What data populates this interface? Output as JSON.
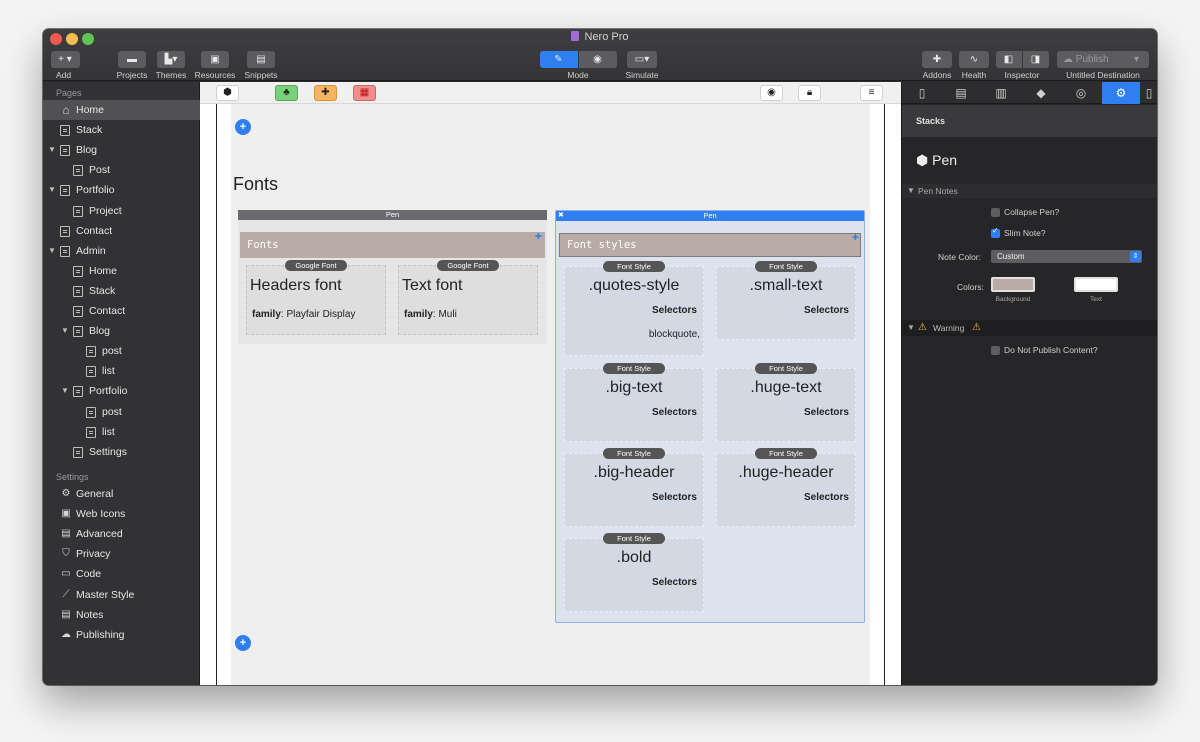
{
  "window": {
    "title": "Nero Pro",
    "traffic_lights": [
      "#ee5a52",
      "#f5bd4f",
      "#5fc454"
    ]
  },
  "toolbar": {
    "add_label": "Add",
    "add_button": "+",
    "projects_label": "Projects",
    "themes_label": "Themes",
    "resources_label": "Resources",
    "snippets_label": "Snippets",
    "mode_label": "Mode",
    "simulate_label": "Simulate",
    "addons_label": "Addons",
    "health_label": "Health",
    "inspector_label": "Inspector",
    "publish_button": "Publish",
    "destination_label": "Untitled Destination"
  },
  "sidebar": {
    "pages_header": "Pages",
    "pages": [
      {
        "label": "Home",
        "selected": true
      },
      {
        "label": "Stack"
      },
      {
        "label": "Blog",
        "expanded": true
      },
      {
        "label": "Post"
      },
      {
        "label": "Portfolio",
        "expanded": true
      },
      {
        "label": "Project"
      },
      {
        "label": "Contact"
      },
      {
        "label": "Admin",
        "expanded": true
      },
      {
        "label": "Home"
      },
      {
        "label": "Stack"
      },
      {
        "label": "Contact"
      },
      {
        "label": "Blog",
        "expanded": true
      },
      {
        "label": "post"
      },
      {
        "label": "list"
      },
      {
        "label": "Portfolio",
        "expanded": true
      },
      {
        "label": "post"
      },
      {
        "label": "list"
      },
      {
        "label": "Settings"
      }
    ],
    "settings_header": "Settings",
    "settings": [
      {
        "label": "General",
        "icon": "gear-icon"
      },
      {
        "label": "Web Icons",
        "icon": "web-icons-icon"
      },
      {
        "label": "Advanced",
        "icon": "advanced-icon"
      },
      {
        "label": "Privacy",
        "icon": "shield-icon"
      },
      {
        "label": "Code",
        "icon": "code-icon"
      },
      {
        "label": "Master Style",
        "icon": "wand-icon"
      },
      {
        "label": "Notes",
        "icon": "notes-icon"
      },
      {
        "label": "Publishing",
        "icon": "cloud-icon"
      }
    ]
  },
  "canvas": {
    "heading": "Fonts",
    "pen_left": {
      "bar_label": "Pen",
      "title": "Fonts",
      "cards": [
        {
          "badge": "Google Font",
          "name": "Headers font",
          "family_key": "family",
          "family_value": ": Playfair Display"
        },
        {
          "badge": "Google Font",
          "name": "Text font",
          "family_key": "family",
          "family_value": ": Muli"
        }
      ]
    },
    "pen_right": {
      "bar_label": "Pen",
      "close": "✖",
      "title": "Font styles",
      "cards": [
        {
          "badge": "Font Style",
          "name": ".quotes-style",
          "selectors": "Selectors",
          "extra": "blockquote,"
        },
        {
          "badge": "Font Style",
          "name": ".small-text",
          "selectors": "Selectors"
        },
        {
          "badge": "Font Style",
          "name": ".big-text",
          "selectors": "Selectors"
        },
        {
          "badge": "Font Style",
          "name": ".huge-text",
          "selectors": "Selectors"
        },
        {
          "badge": "Font Style",
          "name": ".big-header",
          "selectors": "Selectors"
        },
        {
          "badge": "Font Style",
          "name": ".huge-header",
          "selectors": "Selectors"
        },
        {
          "badge": "Font Style",
          "name": ".bold",
          "selectors": "Selectors"
        }
      ]
    },
    "add_button": "+"
  },
  "inspector": {
    "section_title": "Stacks",
    "stack_name": "Pen",
    "pen_notes_header": "Pen Notes",
    "collapse_label": "Collapse Pen?",
    "collapse_checked": false,
    "slim_label": "Slim Note?",
    "slim_checked": true,
    "note_color_label": "Note Color:",
    "note_color_value": "Custom",
    "colors_label": "Colors:",
    "background_label": "Background",
    "text_label": "Text",
    "background_color": "#b8aca4",
    "text_color": "#ffffff",
    "warning_header": "Warning",
    "do_not_publish_label": "Do Not Publish Content?",
    "do_not_publish_checked": false
  },
  "colors": {
    "accent": "#2f7ff0",
    "note_bg": "#b8aca4",
    "pen_bar_left": "#6a6a70",
    "pen_right_bg": "#dde3ee"
  }
}
